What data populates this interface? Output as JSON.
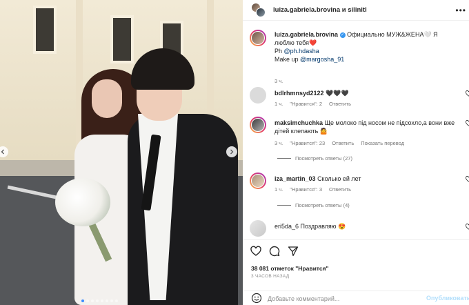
{
  "post": {
    "header_title": "luiza.gabriela.brovina и silinitl",
    "more_icon": "more-icon",
    "caption": {
      "username": "luiza.gabriela.brovina",
      "text": "Официально МУЖ&ЖЕНА🤍 Я люблю тебя❤️",
      "ph_label": "Ph",
      "ph_handle": "@ph.hdasha",
      "makeup_label": "Make up",
      "makeup_handle": "@margosha_91",
      "age": "3 ч."
    },
    "comments": [
      {
        "username": "bdlrhmnsyd2122",
        "text": "🖤🖤🖤",
        "age": "1 ч.",
        "likes": "\"Нравится\": 2",
        "reply": "Ответить"
      },
      {
        "username": "maksimchuchka",
        "text": "Ще молоко під носом не підсохло,а вони вже дітей клепають 🤷",
        "age": "3 ч.",
        "likes": "\"Нравится\": 23",
        "reply": "Ответить",
        "translate": "Показать перевод",
        "view_replies": "Посмотреть ответы (27)"
      },
      {
        "username": "iza_martin_03",
        "text": "Сколько ей лет",
        "age": "1 ч.",
        "likes": "\"Нравится\": 3",
        "reply": "Ответить",
        "view_replies": "Посмотреть ответы (4)"
      },
      {
        "username": "eri5da_6",
        "text": "Поздравляю 😍",
        "age": "",
        "likes": "",
        "reply": ""
      }
    ],
    "likes_text": "38 081 отметок \"Нравится\"",
    "time_text": "3 ЧАСОВ НАЗАД",
    "comment_placeholder": "Добавьте комментарий...",
    "post_button": "Опубликовать",
    "carousel_dots": 8,
    "carousel_active": 0
  },
  "colors": {
    "link": "#00376b",
    "verified": "#3897f0",
    "post_disabled": "#b2dffc",
    "meta": "#737373"
  }
}
